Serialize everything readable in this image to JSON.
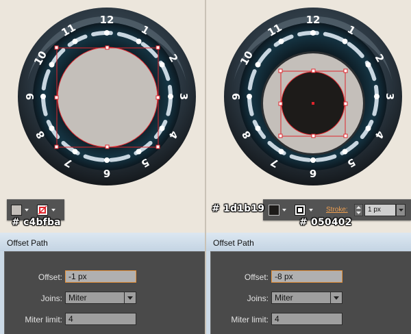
{
  "left": {
    "fill_hex": "# c4bfba",
    "fill_color": "#c4bfba",
    "dial_numbers": [
      "1",
      "2",
      "3",
      "4",
      "5",
      "6",
      "7",
      "8",
      "9",
      "10",
      "11",
      "12"
    ],
    "dialog": {
      "title": "Offset Path",
      "offset_label": "Offset:",
      "offset_value": "-1 px",
      "joins_label": "Joins:",
      "joins_value": "Miter",
      "miter_label": "Miter limit:",
      "miter_value": "4"
    }
  },
  "right": {
    "fill_hex": "# 1d1b19",
    "fill_color": "#1d1b19",
    "stroke_hex": "# 050402",
    "stroke_color": "#050402",
    "stroke_label": "Stroke:",
    "stroke_weight": "1 px",
    "dial_numbers": [
      "1",
      "2",
      "3",
      "4",
      "5",
      "6",
      "7",
      "8",
      "9",
      "10",
      "11",
      "12"
    ],
    "dialog": {
      "title": "Offset Path",
      "offset_label": "Offset:",
      "offset_value": "-8 px",
      "joins_label": "Joins:",
      "joins_value": "Miter",
      "miter_label": "Miter limit:",
      "miter_value": "4"
    }
  },
  "colors": {
    "selection": "#e0252c",
    "dial_ring": "#11222c",
    "dial_mark": "#c8d6e0",
    "canvas_bg": "#ece6dc",
    "panel_bg": "#535353",
    "dialog_accent": "#e8933b"
  },
  "icons": {
    "fill_dropdown": "chevron-down-icon",
    "stroke_none": "no-stroke-icon",
    "stroke_square": "stroke-square-icon"
  }
}
